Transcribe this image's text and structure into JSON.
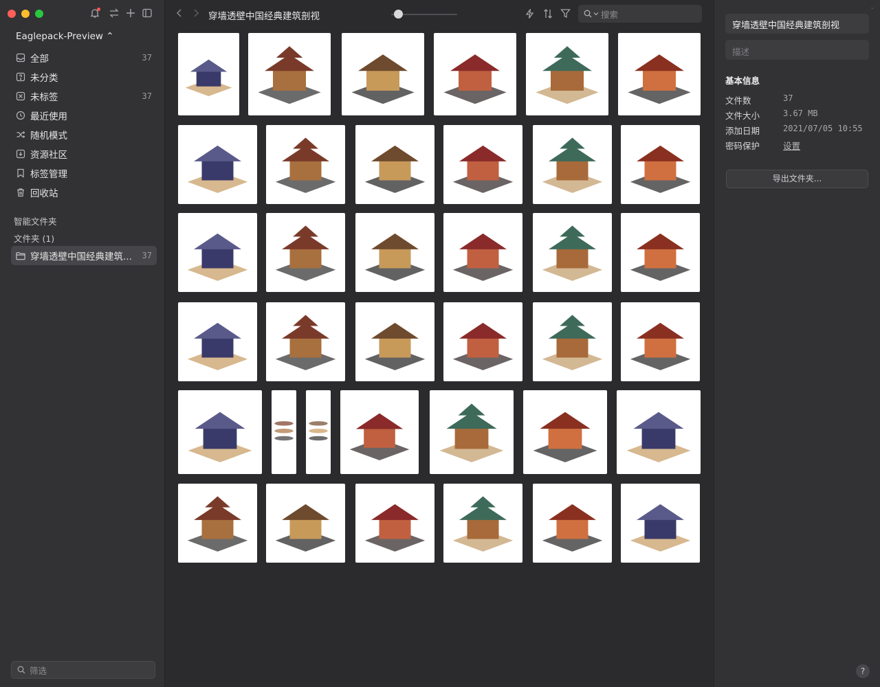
{
  "sidebar": {
    "library_name": "Eaglepack-Preview ⌃",
    "top_icons": [
      "bell-icon",
      "sync-icon",
      "plus-icon",
      "layout-toggle-icon"
    ],
    "nav": [
      {
        "label": "全部",
        "count": "37",
        "icon": "inbox-icon"
      },
      {
        "label": "未分类",
        "count": "",
        "icon": "question-box-icon"
      },
      {
        "label": "未标签",
        "count": "37",
        "icon": "untagged-icon"
      },
      {
        "label": "最近使用",
        "count": "",
        "icon": "clock-icon"
      },
      {
        "label": "随机模式",
        "count": "",
        "icon": "shuffle-icon"
      },
      {
        "label": "资源社区",
        "count": "",
        "icon": "download-box-icon"
      },
      {
        "label": "标签管理",
        "count": "",
        "icon": "bookmark-icon"
      },
      {
        "label": "回收站",
        "count": "",
        "icon": "trash-icon"
      }
    ],
    "smart_folders_label": "智能文件夹",
    "folders_label": "文件夹 (1)",
    "folder": {
      "label": "穿墙透壁中国经典建筑...",
      "count": "37"
    },
    "filter_placeholder": "筛选"
  },
  "toolbar": {
    "title": "穿墙透壁中国经典建筑剖视",
    "search_placeholder": "搜索",
    "zoom_level": 0.1
  },
  "grid": {
    "item_count": 37
  },
  "inspector": {
    "folder_name": "穿墙透壁中国经典建筑剖视",
    "description_placeholder": "描述",
    "heading": "基本信息",
    "rows": [
      {
        "label": "文件数",
        "value": "37"
      },
      {
        "label": "文件大小",
        "value": "3.67 MB"
      },
      {
        "label": "添加日期",
        "value": "2021/07/05 10:55"
      },
      {
        "label": "密码保护",
        "value": "设置"
      }
    ],
    "export_label": "导出文件夹...",
    "help_label": "?"
  },
  "colors": {
    "sidebar_bg": "#323235",
    "main_bg": "#2b2b2d",
    "selected_bg": "#46464a",
    "accent_red": "#fe5f57"
  }
}
